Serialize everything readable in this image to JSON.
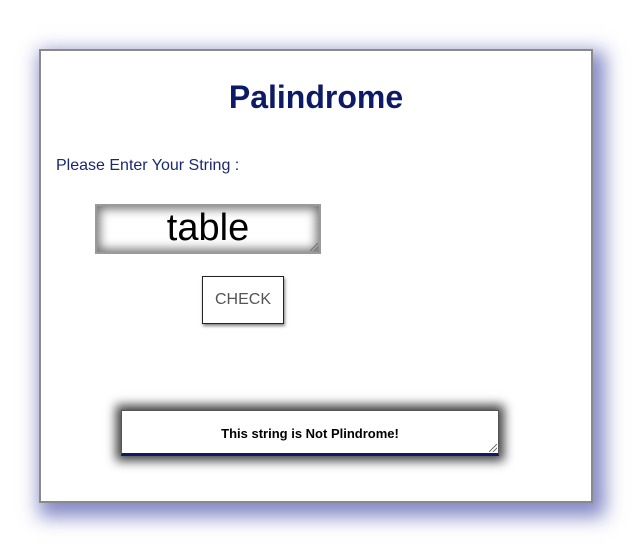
{
  "app": {
    "title": "Palindrome"
  },
  "form": {
    "prompt_label": "Please Enter Your String :",
    "input_value": "table",
    "check_label": "CHECK"
  },
  "result": {
    "text": "This string is Not Plindrome!"
  },
  "colors": {
    "accent": "#0d1a66",
    "shadow": "#1e2896"
  }
}
